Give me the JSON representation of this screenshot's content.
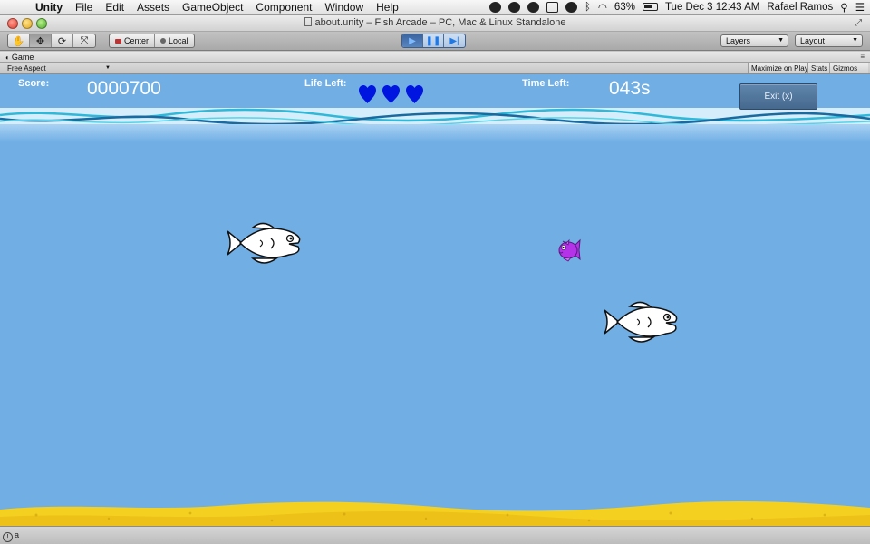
{
  "menubar": {
    "app_name": "Unity",
    "menus": [
      "File",
      "Edit",
      "Assets",
      "GameObject",
      "Component",
      "Window",
      "Help"
    ],
    "battery": "63%",
    "clock": "Tue Dec 3  12:43 AM",
    "user": "Rafael Ramos"
  },
  "window": {
    "title": "about.unity – Fish Arcade – PC, Mac & Linux Standalone"
  },
  "toolbar": {
    "pivot_center": "Center",
    "pivot_local": "Local",
    "layers_label": "Layers",
    "layout_label": "Layout",
    "active_tool": "move",
    "play_state": "playing"
  },
  "game_panel": {
    "tab_label": "Game",
    "aspect": "Free Aspect",
    "maximize_on_play": "Maximize on Play",
    "stats": "Stats",
    "gizmos": "Gizmos"
  },
  "hud": {
    "score_label": "Score:",
    "score_value": "0000700",
    "life_label": "Life Left:",
    "lives": 3,
    "time_label": "Time Left:",
    "time_value": "043s",
    "exit_label": "Exit (x)"
  },
  "colors": {
    "water": "#70aee4",
    "heart": "#0015e0",
    "sand": "#f4d020",
    "player_fish": "#b433e8"
  },
  "console": {
    "message": "a"
  }
}
